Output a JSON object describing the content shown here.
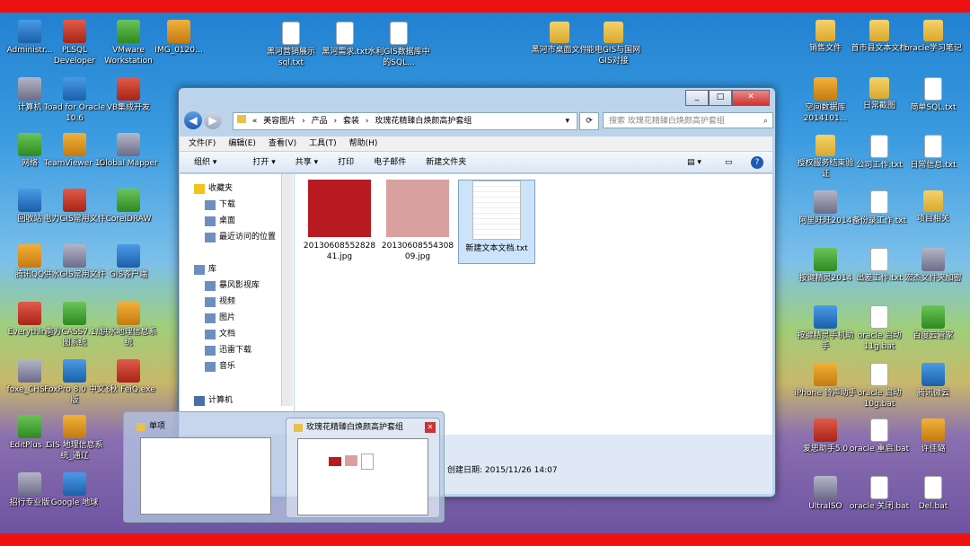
{
  "desktop_left": [
    {
      "label": "Administr...",
      "icon": "folder-icon"
    },
    {
      "label": "PLSQL Developer",
      "icon": "plsql-icon"
    },
    {
      "label": "VMware Workstation",
      "icon": "vmware-icon"
    },
    {
      "label": "IMG_0120...",
      "icon": "image-file-icon"
    },
    {
      "label": "计算机",
      "icon": "computer-icon"
    },
    {
      "label": "Toad for Oracle 10.6",
      "icon": "toad-icon"
    },
    {
      "label": "VB集成开发",
      "icon": "vb-icon"
    },
    {
      "label": "网络",
      "icon": "network-icon"
    },
    {
      "label": "TeamViewer 10",
      "icon": "teamviewer-icon"
    },
    {
      "label": "Global Mapper",
      "icon": "globe-icon"
    },
    {
      "label": "回收站",
      "icon": "recycle-bin-icon"
    },
    {
      "label": "电力GIS常用文件",
      "icon": "people-icon"
    },
    {
      "label": "CorelDRAW",
      "icon": "coreldraw-icon"
    },
    {
      "label": "腾讯QQ",
      "icon": "qq-icon"
    },
    {
      "label": "供水GIS常用文件",
      "icon": "people-icon"
    },
    {
      "label": "GIS客户端",
      "icon": "no-entry-icon"
    },
    {
      "label": "Everything",
      "icon": "search-doc-icon"
    },
    {
      "label": "南方CASS7.1成图系统",
      "icon": "cass-icon"
    },
    {
      "label": "供水地理信息系统",
      "icon": "water-icon"
    },
    {
      "label": "foxe_CHS...",
      "icon": "foxe-icon"
    },
    {
      "label": "FoxPro 8.0 中文版",
      "icon": "foxpro-icon"
    },
    {
      "label": "飞秋 FeiQ.exe",
      "icon": "feiq-icon"
    },
    {
      "label": "EditPlus 3",
      "icon": "editplus-icon"
    },
    {
      "label": "GIS 地理信息系统_通辽",
      "icon": "globe-icon"
    },
    {
      "label": "招行专业版",
      "icon": "cmb-icon"
    },
    {
      "label": "Google 地球",
      "icon": "google-earth-icon"
    }
  ],
  "desktop_top": [
    {
      "label": "黑河营销展示sql.txt"
    },
    {
      "label": "黑河需求.txt"
    },
    {
      "label": "水利GIS数据库中的SQL..."
    },
    {
      "label": "黑河市桌面文件"
    },
    {
      "label": "能电GIS与国网GIS对接"
    }
  ],
  "desktop_right": [
    {
      "label": "销售文件"
    },
    {
      "label": "首市县文本文档"
    },
    {
      "label": "oracle学习笔记"
    },
    {
      "label": "空间数据库2014101..."
    },
    {
      "label": "日常截图"
    },
    {
      "label": "简单SQL.txt"
    },
    {
      "label": "授权服务结束验证"
    },
    {
      "label": "公司工作.txt"
    },
    {
      "label": "日常信息.txt"
    },
    {
      "label": "阿里旺旺2014"
    },
    {
      "label": "备份录工作.txt"
    },
    {
      "label": "项目相关"
    },
    {
      "label": "按键精灵2014"
    },
    {
      "label": "出差工作.txt"
    },
    {
      "label": "宏杰文件夹加密"
    },
    {
      "label": "按键精灵手机助手"
    },
    {
      "label": "oracle 启动11g.bat"
    },
    {
      "label": "百度云管家"
    },
    {
      "label": "iPhone 铃声助手"
    },
    {
      "label": "oracle 启动10g.bat"
    },
    {
      "label": "腾讯微云"
    },
    {
      "label": "爱思助手5.0"
    },
    {
      "label": "oracle 重启.bat"
    },
    {
      "label": "许佳璐"
    },
    {
      "label": "UltraISO"
    },
    {
      "label": "oracle 关闭.bat"
    },
    {
      "label": "Del.bat"
    }
  ],
  "window": {
    "breadcrumb": [
      "«",
      "美容图片",
      "›",
      "产品",
      "›",
      "套装",
      "›",
      "玫瑰花精臻白焕颜高护套组"
    ],
    "search_placeholder": "搜索 玫瑰花精臻白焕颜高护套组",
    "menu": [
      "文件(F)",
      "编辑(E)",
      "查看(V)",
      "工具(T)",
      "帮助(H)"
    ],
    "toolbar": [
      "组织 ▾",
      "打开 ▾",
      "共享 ▾",
      "打印",
      "电子邮件",
      "新建文件夹"
    ],
    "sidebar": [
      {
        "label": "收藏夹",
        "level": 0,
        "icon": "star-icon"
      },
      {
        "label": "下载",
        "level": 1,
        "icon": "download-icon"
      },
      {
        "label": "桌面",
        "level": 1,
        "icon": "desktop-icon"
      },
      {
        "label": "最近访问的位置",
        "level": 1,
        "icon": "recent-icon"
      },
      {
        "label": "库",
        "level": 0,
        "icon": "library-icon"
      },
      {
        "label": "暴风影视库",
        "level": 1,
        "icon": "video-lib-icon"
      },
      {
        "label": "视频",
        "level": 1,
        "icon": "video-icon"
      },
      {
        "label": "图片",
        "level": 1,
        "icon": "picture-icon"
      },
      {
        "label": "文档",
        "level": 1,
        "icon": "document-icon"
      },
      {
        "label": "迅雷下载",
        "level": 1,
        "icon": "thunder-icon"
      },
      {
        "label": "音乐",
        "level": 1,
        "icon": "music-icon"
      },
      {
        "label": "计算机",
        "level": 0,
        "icon": "computer-icon"
      }
    ],
    "files": [
      {
        "name": "20130608552828 41.jpg",
        "kind": "jpg",
        "color": "#b81a22"
      },
      {
        "name": "20130608554308 09.jpg",
        "kind": "jpg",
        "color": "#d9a0a0"
      },
      {
        "name": "新建文本文档.txt",
        "kind": "txt",
        "color": "#ffffff",
        "selected": true
      }
    ],
    "status_text": "创建日期: 2015/11/26 14:07"
  },
  "thumbnails": [
    {
      "title": "单项"
    },
    {
      "title": "玫瑰花精臻白焕颜高护套组",
      "close": "✕"
    }
  ],
  "colors": {
    "red_bar": "#ee1111",
    "window_frame": "#bcd3ec",
    "selected": "#cce3f9"
  }
}
